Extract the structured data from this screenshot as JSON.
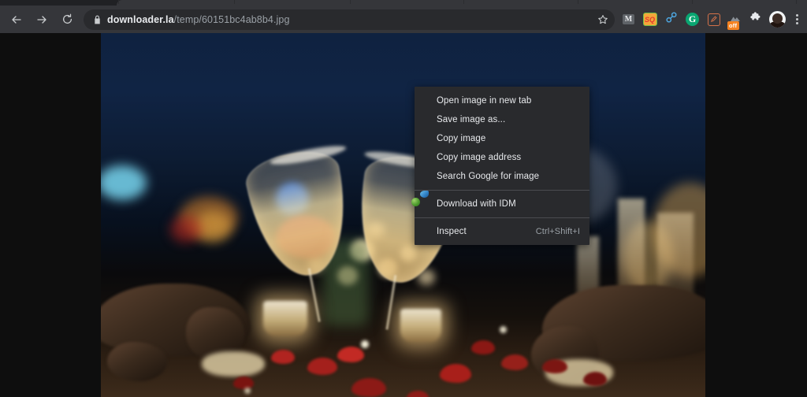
{
  "browser": {
    "toolbar": {
      "back_icon": "back-arrow-icon",
      "forward_icon": "forward-arrow-icon",
      "reload_icon": "reload-icon",
      "lock_icon": "lock-icon",
      "star_icon": "bookmark-star-icon",
      "url_domain": "downloader.la",
      "url_path": "/temp/60151bc4ab8b4.jpg",
      "url_full": "downloader.la/temp/60151bc4ab8b4.jpg"
    },
    "extensions": [
      {
        "name": "mail-extension-icon",
        "glyph": "M"
      },
      {
        "name": "sq-extension-icon",
        "glyph": "SQ"
      },
      {
        "name": "link-extension-icon",
        "glyph": "⚭"
      },
      {
        "name": "grammar-extension-icon",
        "glyph": "G"
      },
      {
        "name": "notepad-extension-icon",
        "glyph": "✎"
      },
      {
        "name": "image-downloader-extension-icon",
        "glyph": "⛰",
        "badge": "off"
      },
      {
        "name": "extensions-puzzle-icon",
        "glyph": "🧩"
      }
    ],
    "profile": {
      "name": "profile-avatar"
    },
    "menu_icon": "chrome-menu-kebab-icon"
  },
  "context_menu": {
    "items": [
      {
        "label": "Open image in new tab",
        "accel": "",
        "icon": "",
        "separator_after": false
      },
      {
        "label": "Save image as...",
        "accel": "",
        "icon": "",
        "separator_after": false
      },
      {
        "label": "Copy image",
        "accel": "",
        "icon": "",
        "separator_after": false
      },
      {
        "label": "Copy image address",
        "accel": "",
        "icon": "",
        "separator_after": false
      },
      {
        "label": "Search Google for image",
        "accel": "",
        "icon": "",
        "separator_after": true
      },
      {
        "label": "Download with IDM",
        "accel": "",
        "icon": "idm-icon",
        "separator_after": true
      },
      {
        "label": "Inspect",
        "accel": "Ctrl+Shift+I",
        "icon": "",
        "separator_after": false
      }
    ]
  },
  "content": {
    "image": {
      "name": "champagne-toast-photo",
      "alt": "Two champagne glasses toasting over a candlelit table with red rose petals at night",
      "background_color": "#0f2240",
      "accent_warm": "#e0ae66",
      "accent_blue": "#1f6fd0"
    },
    "page_background": "#0e0e0e"
  }
}
